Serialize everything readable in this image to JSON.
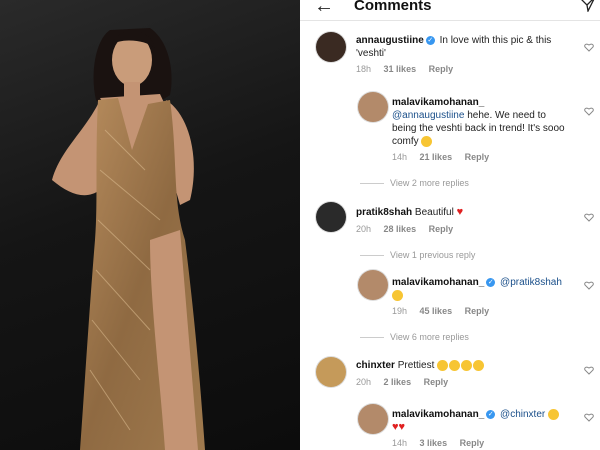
{
  "header": {
    "title": "Comments"
  },
  "comments": [
    {
      "user": "annaugustiine",
      "verified": true,
      "text": "In love with this pic & this 'veshti'",
      "time": "18h",
      "likes": "31 likes",
      "reply": "Reply"
    },
    {
      "user": "malavikamohanan_",
      "verified": false,
      "mention": "@annaugustiine",
      "text": "hehe. We need to being the veshti back in trend! It's sooo comfy",
      "time": "14h",
      "likes": "21 likes",
      "reply": "Reply"
    },
    {
      "view_more": "View 2 more replies"
    },
    {
      "user": "pratik8shah",
      "text": "Beautiful",
      "time": "20h",
      "likes": "28 likes",
      "reply": "Reply"
    },
    {
      "view_prev": "View 1 previous reply"
    },
    {
      "user": "malavikamohanan_",
      "verified": true,
      "mention": "@pratik8shah",
      "time": "19h",
      "likes": "45 likes",
      "reply": "Reply"
    },
    {
      "view_more2": "View 6 more replies"
    },
    {
      "user": "chinxter",
      "text": "Prettiest",
      "time": "20h",
      "likes": "2 likes",
      "reply": "Reply"
    },
    {
      "user": "malavikamohanan_",
      "verified": true,
      "mention": "@chinxter",
      "time": "14h",
      "likes": "3 likes",
      "reply": "Reply"
    }
  ]
}
